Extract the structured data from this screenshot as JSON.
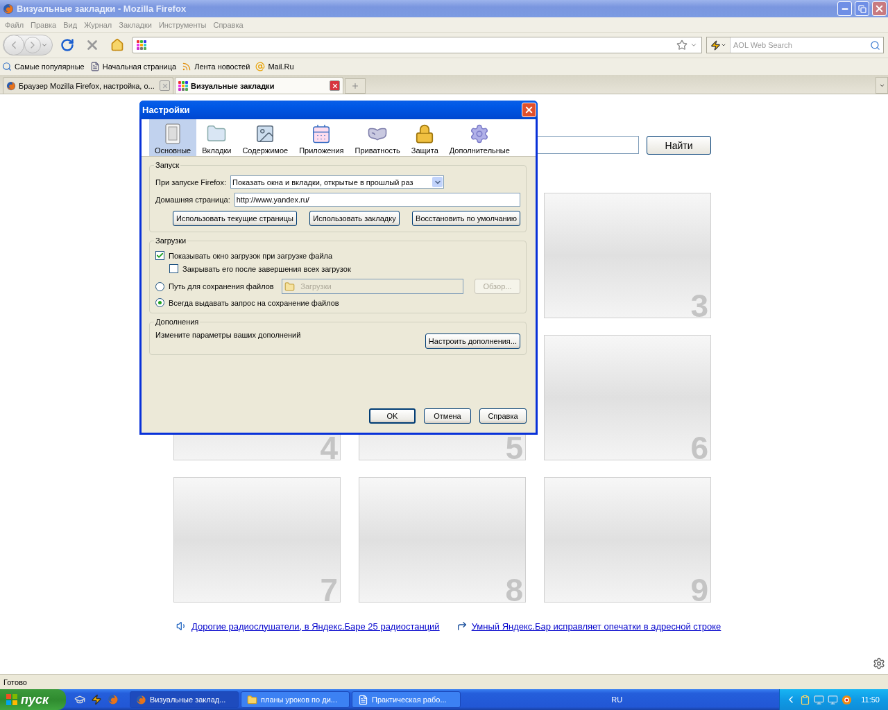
{
  "window": {
    "title": "Визуальные закладки - Mozilla Firefox"
  },
  "menu": [
    "Файл",
    "Правка",
    "Вид",
    "Журнал",
    "Закладки",
    "Инструменты",
    "Справка"
  ],
  "search_engine": {
    "placeholder": "AOL Web Search"
  },
  "bookmarks": [
    "Самые популярные",
    "Начальная страница",
    "Лента новостей",
    "Mail.Ru"
  ],
  "tabs": [
    {
      "label": "Браузер Mozilla Firefox, настройка, о...",
      "selected": false
    },
    {
      "label": "Визуальные закладки",
      "selected": true
    }
  ],
  "page": {
    "search_button": "Найти",
    "thumbnails": [
      "3",
      "4",
      "5",
      "6",
      "7",
      "8",
      "9"
    ],
    "links": [
      "Дорогие радиослушатели, в Яндекс.Баре 25 радиостанций",
      "Умный Яндекс.Бар исправляет опечатки в адресной строке"
    ]
  },
  "dialog": {
    "title": "Настройки",
    "panes": [
      {
        "label": "Основные",
        "selected": true
      },
      {
        "label": "Вкладки",
        "selected": false
      },
      {
        "label": "Содержимое",
        "selected": false
      },
      {
        "label": "Приложения",
        "selected": false
      },
      {
        "label": "Приватность",
        "selected": false
      },
      {
        "label": "Защита",
        "selected": false
      },
      {
        "label": "Дополнительные",
        "selected": false
      }
    ],
    "startup": {
      "legend": "Запуск",
      "on_start_label": "При запуске Firefox:",
      "on_start_value": "Показать окна и вкладки, открытые в прошлый раз",
      "home_label": "Домашняя страница:",
      "home_value": "http://www.yandex.ru/",
      "buttons": [
        "Использовать текущие страницы",
        "Использовать закладку",
        "Восстановить по умолчанию"
      ]
    },
    "downloads": {
      "legend": "Загрузки",
      "show_window": {
        "label": "Показывать окно загрузок при загрузке файла",
        "checked": true
      },
      "close_when_done": {
        "label": "Закрывать его после завершения всех загрузок",
        "checked": false
      },
      "save_options": [
        {
          "label": "Путь для сохранения файлов",
          "selected": false
        },
        {
          "label": "Всегда выдавать запрос на сохранение файлов",
          "selected": true
        }
      ],
      "folder": {
        "value": "Загрузки",
        "disabled": true
      },
      "browse": {
        "label": "Обзор...",
        "disabled": true
      }
    },
    "addons": {
      "legend": "Дополнения",
      "text": "Измените параметры ваших дополнений",
      "button": "Настроить дополнения..."
    },
    "buttons": [
      "OK",
      "Отмена",
      "Справка"
    ]
  },
  "status_bar": "Готово",
  "taskbar": {
    "start": "пуск",
    "tasks": [
      {
        "label": "Визуальные заклад...",
        "selected": true
      },
      {
        "label": "планы уроков по ди...",
        "selected": false
      },
      {
        "label": "Практическая рабо...",
        "selected": false
      }
    ],
    "language": "RU",
    "clock": "11:50"
  }
}
